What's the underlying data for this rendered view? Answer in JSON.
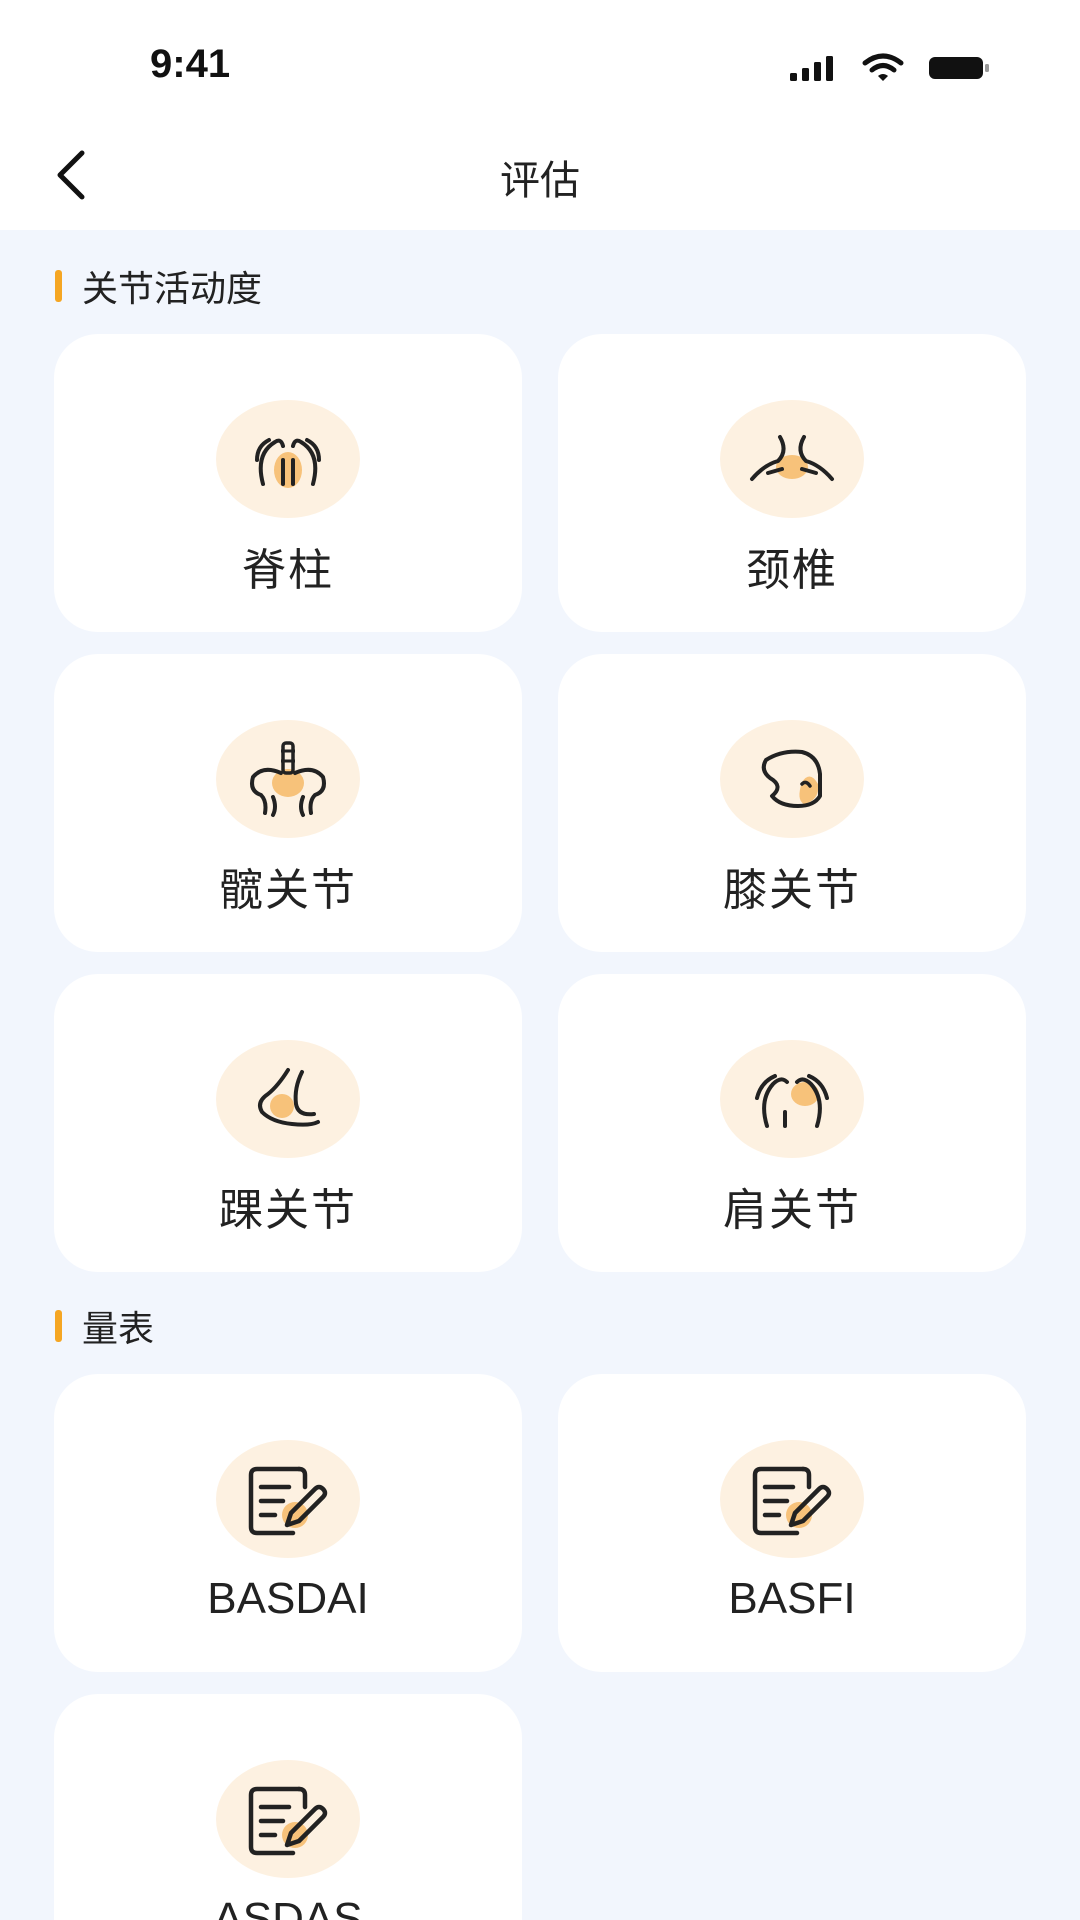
{
  "status_bar": {
    "time": "9:41"
  },
  "nav": {
    "title": "评估"
  },
  "sections": [
    {
      "title": "关节活动度"
    },
    {
      "title": "量表"
    }
  ],
  "joint_cards": [
    {
      "label": "脊柱",
      "icon": "spine-icon"
    },
    {
      "label": "颈椎",
      "icon": "neck-icon"
    },
    {
      "label": "髋关节",
      "icon": "hip-icon"
    },
    {
      "label": "膝关节",
      "icon": "knee-icon"
    },
    {
      "label": "踝关节",
      "icon": "ankle-icon"
    },
    {
      "label": "肩关节",
      "icon": "shoulder-icon"
    }
  ],
  "scale_cards": [
    {
      "label": "BASDAI",
      "icon": "form-edit-icon"
    },
    {
      "label": "BASFI",
      "icon": "form-edit-icon"
    },
    {
      "label": "ASDAS",
      "icon": "form-edit-icon"
    }
  ],
  "colors": {
    "accent": "#f5a623",
    "icon_bg": "#fdf1e1",
    "content_bg": "#f2f6fd"
  }
}
